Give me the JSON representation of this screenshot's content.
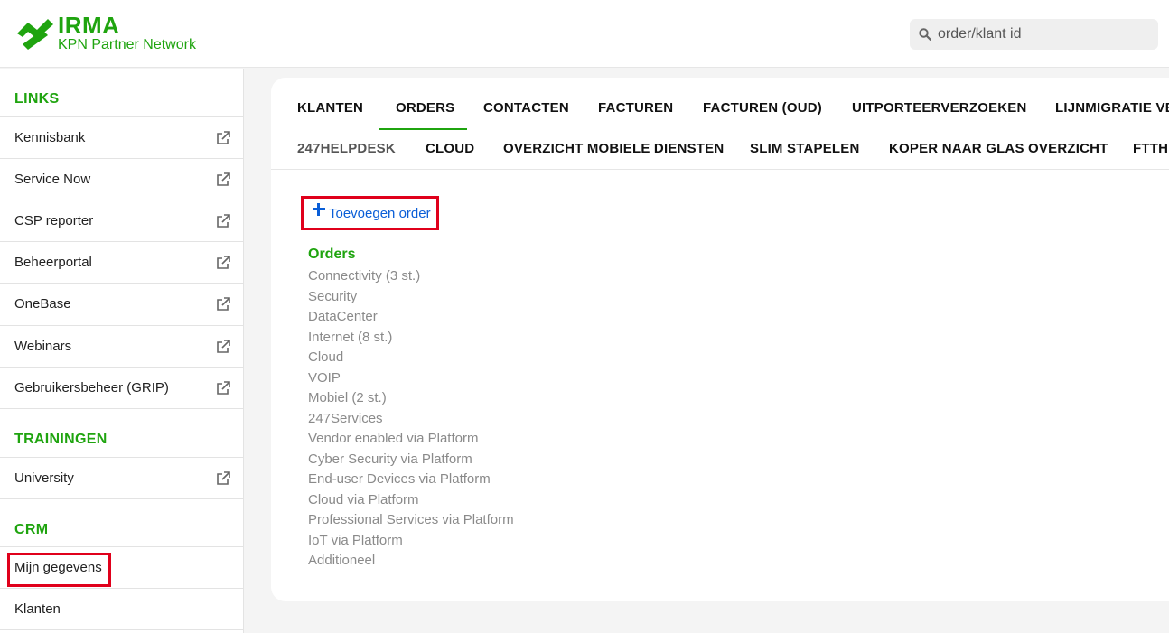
{
  "header": {
    "logo_title": "IRMA",
    "logo_subtitle": "KPN Partner Network",
    "search_placeholder": "order/klant id",
    "brand_color": "#1fa40f"
  },
  "sidebar": {
    "links_title": "LINKS",
    "links": [
      {
        "label": "Kennisbank",
        "icon": "external-link-icon"
      },
      {
        "label": "Service Now",
        "icon": "external-link-icon"
      },
      {
        "label": "CSP reporter",
        "icon": "external-link-icon"
      },
      {
        "label": "Beheerportal",
        "icon": "external-link-icon"
      },
      {
        "label": "OneBase",
        "icon": "external-link-icon"
      },
      {
        "label": "Webinars",
        "icon": "external-link-icon"
      },
      {
        "label": "Gebruikersbeheer (GRIP)",
        "icon": "external-link-icon"
      }
    ],
    "trainingen_title": "TRAININGEN",
    "trainingen": [
      {
        "label": "University",
        "icon": "external-link-icon"
      }
    ],
    "crm_title": "CRM",
    "crm": [
      {
        "label": "Mijn gegevens"
      },
      {
        "label": "Klanten"
      }
    ]
  },
  "tabs": {
    "row1": [
      "KLANTEN",
      "ORDERS",
      "CONTACTEN",
      "FACTUREN",
      "FACTUREN (OUD)",
      "UITPORTEERVERZOEKEN",
      "LIJNMIGRATIE VE"
    ],
    "row2": [
      "247HELPDESK",
      "CLOUD",
      "OVERZICHT MOBIELE DIENSTEN",
      "SLIM STAPELEN",
      "KOPER NAAR GLAS OVERZICHT",
      "FTTH"
    ],
    "active": "ORDERS"
  },
  "main": {
    "add_order_label": "Toevoegen order",
    "orders_title": "Orders",
    "order_items": [
      "Connectivity (3 st.)",
      "Security",
      "DataCenter",
      "Internet (8 st.)",
      "Cloud",
      "VOIP",
      "Mobiel (2 st.)",
      "247Services",
      "Vendor enabled via Platform",
      "Cyber Security via Platform",
      "End-user Devices via Platform",
      "Cloud via Platform",
      "Professional Services via Platform",
      "IoT via Platform",
      "Additioneel"
    ]
  }
}
